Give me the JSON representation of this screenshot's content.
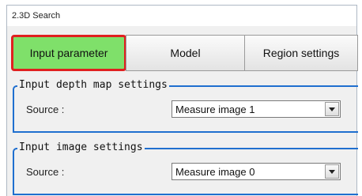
{
  "window": {
    "title": "2.3D Search"
  },
  "tabs": [
    {
      "label": "Input parameter",
      "active": true
    },
    {
      "label": "Model",
      "active": false
    },
    {
      "label": "Region settings",
      "active": false
    }
  ],
  "groups": {
    "depth_map": {
      "title": "Input depth map settings",
      "source_label": "Source :",
      "source_value": "Measure image 1",
      "icon": "chevron-down-icon"
    },
    "image": {
      "title": "Input image settings",
      "source_label": "Source :",
      "source_value": "Measure image 0",
      "icon": "chevron-down-icon"
    }
  },
  "colors": {
    "active_tab_fill": "#7fe06a",
    "active_tab_outline": "#e02020",
    "group_border": "#1f6fcf"
  }
}
